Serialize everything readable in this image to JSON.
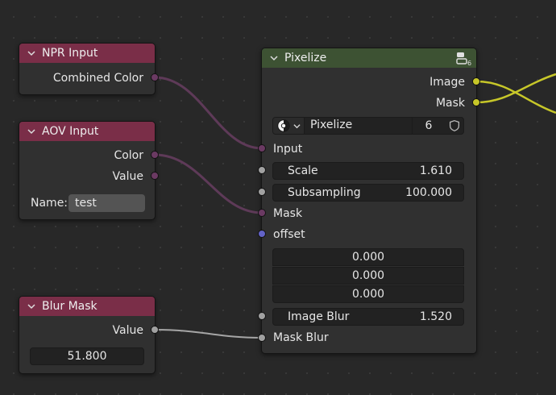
{
  "nodes": {
    "npr_input": {
      "title": "NPR Input",
      "output": "Combined Color"
    },
    "aov_input": {
      "title": "AOV Input",
      "outputs": [
        "Color",
        "Value"
      ],
      "name_label": "Name:",
      "name_value": "test"
    },
    "blur_mask": {
      "title": "Blur Mask",
      "output": "Value",
      "value": "51.800"
    },
    "pixelize": {
      "title": "Pixelize",
      "outputs": [
        "Image",
        "Mask"
      ],
      "group_name": "Pixelize",
      "user_count": "6",
      "inputs": {
        "input": "Input",
        "scale_label": "Scale",
        "scale_value": "1.610",
        "subsampling_label": "Subsampling",
        "subsampling_value": "100.000",
        "mask": "Mask",
        "offset": "offset",
        "offset_values": [
          "0.000",
          "0.000",
          "0.000"
        ],
        "image_blur_label": "Image Blur",
        "image_blur_value": "1.520",
        "mask_blur": "Mask Blur"
      }
    }
  },
  "colors": {
    "header_input": "#7a2e48",
    "header_group": "#3d5233",
    "socket_color": "#6b3a63",
    "socket_image": "#c7c729",
    "socket_float": "#a1a1a1",
    "socket_vector": "#6363c7"
  }
}
